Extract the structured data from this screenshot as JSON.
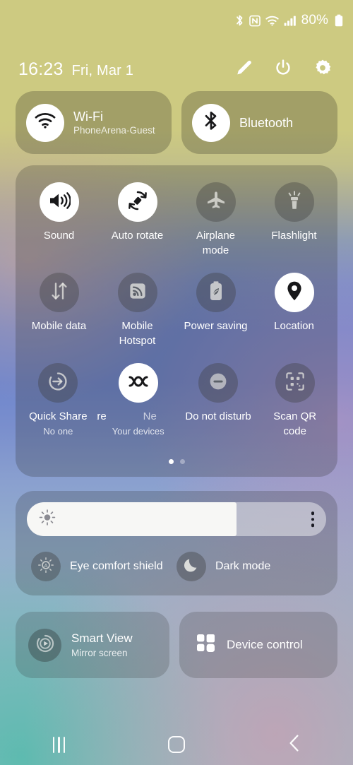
{
  "status_bar": {
    "icons": [
      "bluetooth-icon",
      "nfc-icon",
      "wifi-icon",
      "signal-icon"
    ],
    "battery_percent": "80%",
    "battery_icon": "battery-icon"
  },
  "header": {
    "time": "16:23",
    "date": "Fri, Mar 1",
    "actions": [
      {
        "name": "edit-button",
        "icon": "pencil-icon"
      },
      {
        "name": "power-button",
        "icon": "power-icon"
      },
      {
        "name": "settings-button",
        "icon": "gear-icon"
      }
    ]
  },
  "connections": [
    {
      "title": "Wi-Fi",
      "subtitle": "PhoneArena-Guest",
      "icon": "wifi-icon",
      "active": true
    },
    {
      "title": "Bluetooth",
      "subtitle": "",
      "icon": "bluetooth-icon",
      "active": true
    }
  ],
  "tiles": {
    "row1": [
      {
        "label": "Sound",
        "sub": "",
        "icon": "speaker-icon",
        "active": true
      },
      {
        "label": "Auto rotate",
        "sub": "",
        "icon": "auto-rotate-icon",
        "active": true
      },
      {
        "label": "Airplane mode",
        "sub": "",
        "icon": "airplane-icon",
        "active": false
      },
      {
        "label": "Flashlight",
        "sub": "",
        "icon": "flashlight-icon",
        "active": false
      }
    ],
    "row2": [
      {
        "label": "Mobile data",
        "sub": "",
        "icon": "data-transfer-icon",
        "active": false
      },
      {
        "label": "Mobile Hotspot",
        "sub": "",
        "icon": "hotspot-icon",
        "active": false
      },
      {
        "label": "Power saving",
        "sub": "",
        "icon": "battery-leaf-icon",
        "active": false
      },
      {
        "label": "Location",
        "sub": "",
        "icon": "location-pin-icon",
        "active": true
      }
    ],
    "row3": [
      {
        "label": "Quick Share",
        "sub": "No one",
        "icon": "quick-share-icon",
        "active": false
      },
      {
        "label_fragment_a": "hare",
        "label_fragment_b": "Ne",
        "sub": "Your devices",
        "icon": "nearby-share-icon",
        "active": true
      },
      {
        "label": "Do not disturb",
        "sub": "",
        "icon": "minus-circle-icon",
        "active": false
      },
      {
        "label": "Scan QR code",
        "sub": "",
        "icon": "qr-scan-icon",
        "active": false
      }
    ],
    "page_dots": {
      "count": 2,
      "active_index": 0
    }
  },
  "brightness": {
    "level_percent": 70,
    "sun_icon": "brightness-sun-icon",
    "more_icon": "three-dot-menu-icon"
  },
  "display_modes": [
    {
      "label": "Eye comfort shield",
      "icon": "eye-comfort-icon",
      "active": false
    },
    {
      "label": "Dark mode",
      "icon": "moon-icon",
      "active": false
    }
  ],
  "bottom_cards": [
    {
      "title": "Smart View",
      "subtitle": "Mirror screen",
      "icon": "smart-view-icon"
    },
    {
      "title": "Device control",
      "subtitle": "",
      "icon": "grid-squares-icon"
    }
  ],
  "nav_bar": [
    {
      "name": "recents-button",
      "icon": "recents-icon"
    },
    {
      "name": "home-button",
      "icon": "home-icon"
    },
    {
      "name": "back-button",
      "icon": "back-chevron-icon"
    }
  ]
}
